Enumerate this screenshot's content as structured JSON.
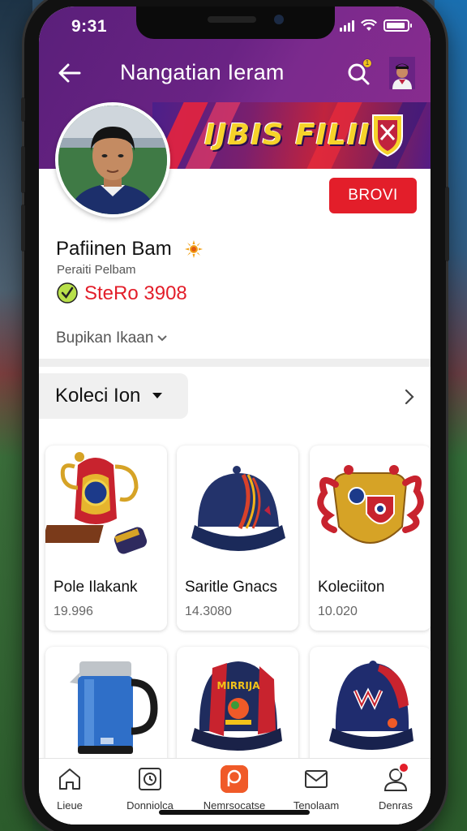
{
  "status_bar": {
    "time": "9:31"
  },
  "header": {
    "title": "Nangatian Ieram",
    "search_badge": "1"
  },
  "banner": {
    "text": "IJBIS FILII"
  },
  "profile": {
    "name": "Pafiinen Bam",
    "handle": "Peraiti Pelbam",
    "stat": "SteRo 3908",
    "follow_label": "BROVI",
    "dropdown_label": "Bupikan Ikaan"
  },
  "collection": {
    "label": "Koleci Ion"
  },
  "products": [
    {
      "title": "Pole Ilakank",
      "price": "19.996",
      "icon": "trophy-icon"
    },
    {
      "title": "Saritle Gnacs",
      "price": "14.3080",
      "icon": "cap-icon"
    },
    {
      "title": "Koleciiton",
      "price": "10.020",
      "icon": "emblem-icon"
    },
    {
      "title": "",
      "price": "",
      "icon": "kettle-icon"
    },
    {
      "title": "",
      "price": "",
      "icon": "cap-icon"
    },
    {
      "title": "",
      "price": "",
      "icon": "cap-icon"
    }
  ],
  "bottom_nav": [
    {
      "label": "Lieue",
      "icon": "home-icon"
    },
    {
      "label": "Donniolca",
      "icon": "clock-icon"
    },
    {
      "label": "Nemrsocatse",
      "icon": "bag-icon"
    },
    {
      "label": "Tenolaam",
      "icon": "mail-icon"
    },
    {
      "label": "Denras",
      "icon": "profile-icon"
    }
  ],
  "colors": {
    "accent_red": "#e31e2a",
    "header_purple": "#6a2384",
    "active_orange": "#f05a28"
  }
}
